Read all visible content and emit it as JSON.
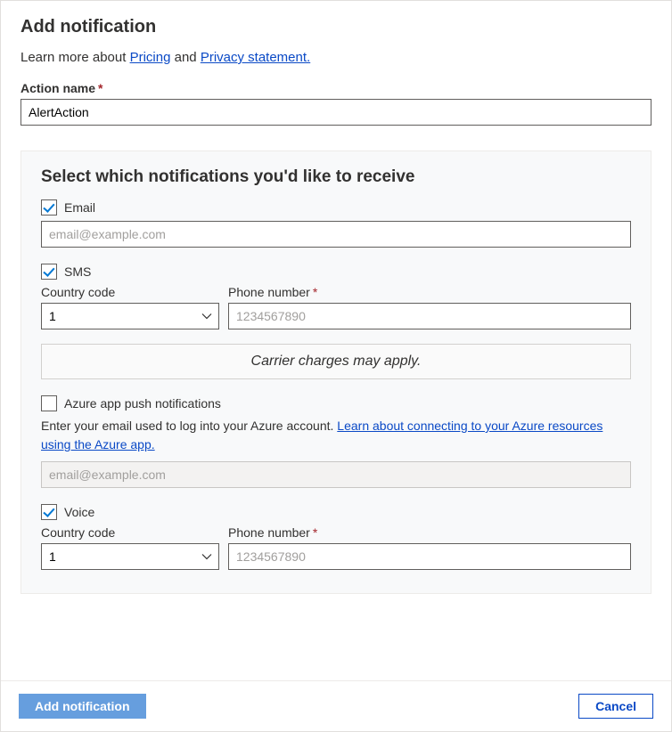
{
  "header": {
    "title": "Add notification",
    "learnPrefix": "Learn more about ",
    "pricingLink": "Pricing",
    "and": " and ",
    "privacyLink": " Privacy statement."
  },
  "actionName": {
    "label": "Action name",
    "value": "AlertAction"
  },
  "section": {
    "title": "Select which notifications you'd like to receive"
  },
  "email": {
    "label": "Email",
    "checked": true,
    "placeholder": "email@example.com",
    "value": ""
  },
  "sms": {
    "label": "SMS",
    "checked": true,
    "countryCodeLabel": "Country code",
    "countryCodeValue": "1",
    "phoneLabel": "Phone number",
    "phonePlaceholder": "1234567890",
    "phoneValue": "",
    "carrierNotice": "Carrier charges may apply."
  },
  "azurePush": {
    "label": "Azure app push notifications",
    "checked": false,
    "helperPrefix": "Enter your email used to log into your Azure account.  ",
    "helperLink": "Learn about connecting to your Azure resources using the Azure app.",
    "placeholder": "email@example.com",
    "value": ""
  },
  "voice": {
    "label": "Voice",
    "checked": true,
    "countryCodeLabel": "Country code",
    "countryCodeValue": "1",
    "phoneLabel": "Phone number",
    "phonePlaceholder": "1234567890",
    "phoneValue": ""
  },
  "footer": {
    "primary": "Add notification",
    "secondary": "Cancel"
  }
}
